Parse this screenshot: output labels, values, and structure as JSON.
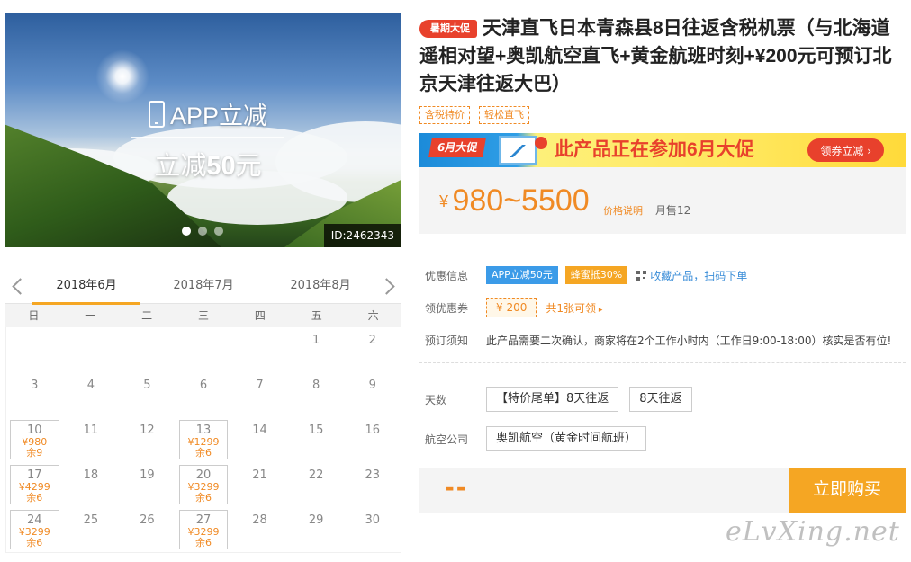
{
  "hero": {
    "promo_line1": "APP立减",
    "promo_line2_prefix": "立减",
    "promo_line2_amount": "50",
    "promo_line2_suffix": "元",
    "id_badge": "ID:2462343",
    "slide_count": 3,
    "active_slide": 1
  },
  "calendar": {
    "months": [
      "2018年6月",
      "2018年7月",
      "2018年8月"
    ],
    "active_month": "2018年6月",
    "weekdays": [
      "日",
      "一",
      "二",
      "三",
      "四",
      "五",
      "六"
    ],
    "weeks": [
      [
        null,
        null,
        null,
        null,
        null,
        {
          "day": "1"
        },
        {
          "day": "2"
        }
      ],
      [
        {
          "day": "3"
        },
        {
          "day": "4"
        },
        {
          "day": "5"
        },
        {
          "day": "6"
        },
        {
          "day": "7"
        },
        {
          "day": "8"
        },
        {
          "day": "9"
        }
      ],
      [
        {
          "day": "10",
          "price": "¥980",
          "remain": "余9"
        },
        {
          "day": "11"
        },
        {
          "day": "12"
        },
        {
          "day": "13",
          "price": "¥1299",
          "remain": "余6"
        },
        {
          "day": "14"
        },
        {
          "day": "15"
        },
        {
          "day": "16"
        }
      ],
      [
        {
          "day": "17",
          "price": "¥4299",
          "remain": "余6"
        },
        {
          "day": "18"
        },
        {
          "day": "19"
        },
        {
          "day": "20",
          "price": "¥3299",
          "remain": "余6"
        },
        {
          "day": "21"
        },
        {
          "day": "22"
        },
        {
          "day": "23"
        }
      ],
      [
        {
          "day": "24",
          "price": "¥3299",
          "remain": "余6"
        },
        {
          "day": "25"
        },
        {
          "day": "26"
        },
        {
          "day": "27",
          "price": "¥3299",
          "remain": "余6"
        },
        {
          "day": "28"
        },
        {
          "day": "29"
        },
        {
          "day": "30"
        }
      ]
    ]
  },
  "product": {
    "summer_tag": "暑期大促",
    "title": "天津直飞日本青森县8日往返含税机票（与北海道遥相对望+奥凯航空直飞+黄金航班时刻+¥200元可预订北京天津往返大巴）",
    "tags": [
      "含税特价",
      "轻松直飞"
    ]
  },
  "banner": {
    "badge": "6月大促",
    "text": "此产品正在参加6月大促",
    "button": "领券立减 ›"
  },
  "price": {
    "currency": "¥",
    "range": "980~5500",
    "explain": "价格说明",
    "monthly_sales": "月售12"
  },
  "info": {
    "discount_label": "优惠信息",
    "discount_app": "APP立减50元",
    "discount_honey": "蜂蜜抵30%",
    "favorite": "收藏产品，扫码下单",
    "coupon_label": "领优惠券",
    "coupon_value": "¥ 200",
    "coupon_count": "共1张可领",
    "notice_label": "预订须知",
    "notice_text": "此产品需要二次确认，商家将在2个工作小时内（工作日9:00-18:00）核实是否有位!"
  },
  "options": {
    "days_label": "天数",
    "days": [
      "【特价尾单】8天往返",
      "8天往返"
    ],
    "airline_label": "航空公司",
    "airlines": [
      "奥凯航空（黄金时间航班）"
    ]
  },
  "buy": {
    "total": "--",
    "button": "立即购买"
  },
  "watermark": "eLvXing.net",
  "colors": {
    "accent_orange": "#f5a623",
    "price_orange": "#f08a24",
    "promo_red": "#e8412c",
    "app_blue": "#3b9be8"
  }
}
